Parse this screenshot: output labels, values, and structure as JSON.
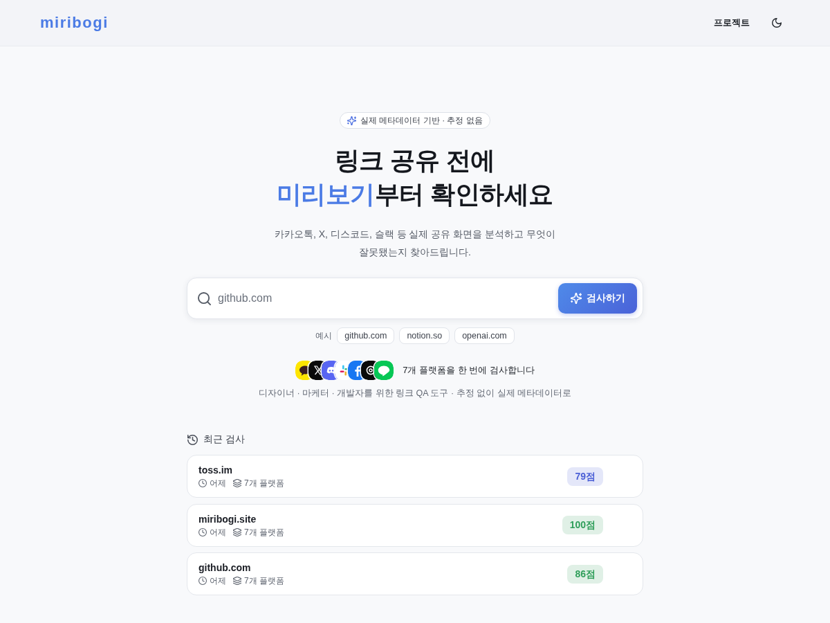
{
  "header": {
    "logo": "miribogi",
    "nav": [
      {
        "label": "프로젝트"
      }
    ]
  },
  "hero": {
    "badge": "실제 메타데이터 기반 · 추정 없음",
    "title": {
      "line_1": "링크 공유 전에",
      "highlight": "미리보기",
      "line_2_rest": "부터 확인하세요"
    },
    "subtitle": "카카오톡, X, 디스코드, 슬랙 등 실제 공유 화면을 분석하고 무엇이\n잘못됐는지 찾아드립니다."
  },
  "search": {
    "placeholder": "github.com",
    "button": "검사하기"
  },
  "examples": {
    "label": "예시",
    "items": [
      "github.com",
      "notion.so",
      "openai.com"
    ]
  },
  "platforms": {
    "caption": "7개 플랫폼을 한 번에 검사합니다"
  },
  "tagline": "디자이너 · 마케터 · 개발자를 위한 링크 QA 도구 · 추정 없이 실제 메타데이터로",
  "recent": {
    "heading": "최근 검사",
    "items": [
      {
        "domain": "toss.im",
        "time": "어제",
        "platforms": "7개 플랫폼",
        "score": "79점",
        "color": "#4a5fd6"
      },
      {
        "domain": "miribogi.site",
        "time": "어제",
        "platforms": "7개 플랫폼",
        "score": "100점",
        "color": "#2f9e5a"
      },
      {
        "domain": "github.com",
        "time": "어제",
        "platforms": "7개 플랫폼",
        "score": "86점",
        "color": "#2f9e5a"
      }
    ]
  }
}
